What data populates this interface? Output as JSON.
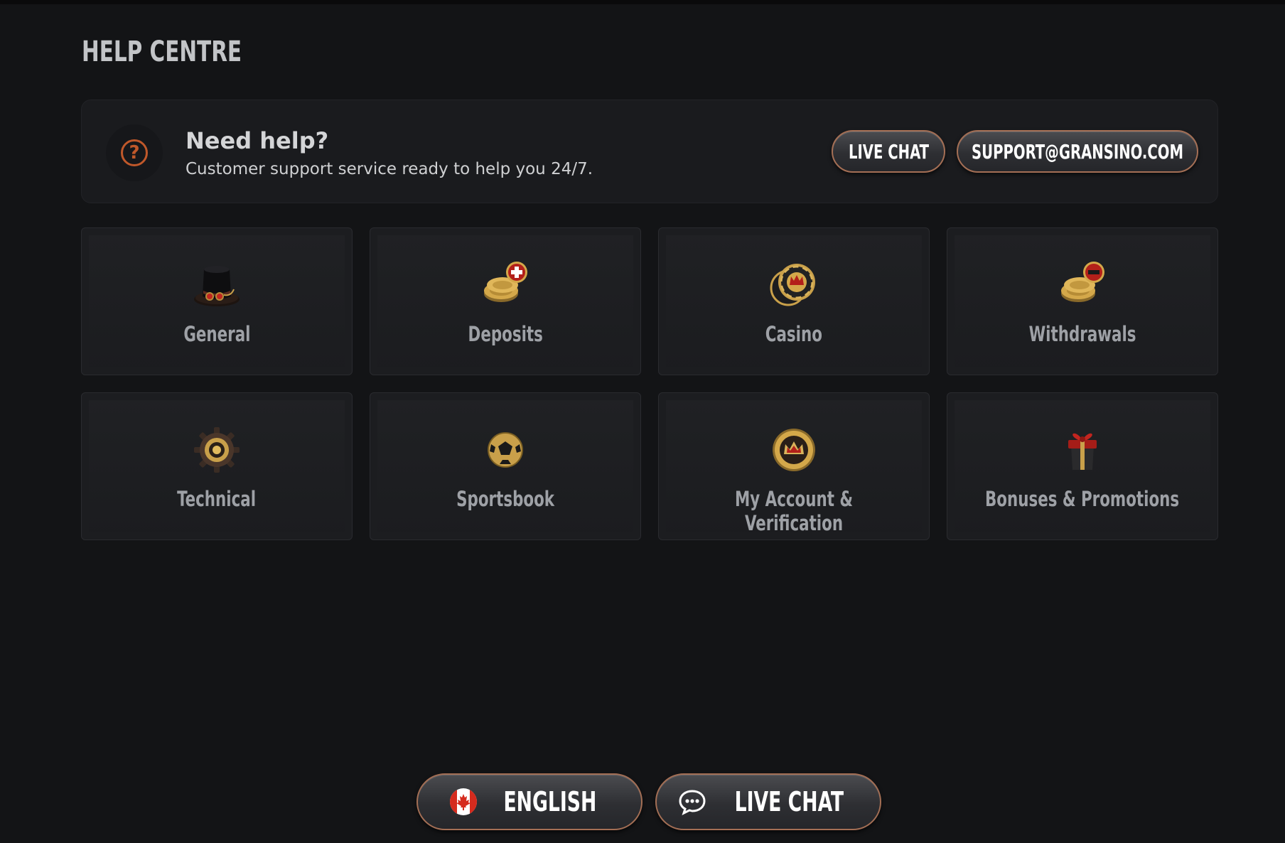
{
  "page": {
    "title": "HELP CENTRE"
  },
  "help": {
    "heading": "Need help?",
    "subtext": "Customer support service ready to help you 24/7.",
    "live_chat_label": "LIVE CHAT",
    "email_label": "SUPPORT@GRANSINO.COM"
  },
  "categories": [
    {
      "label": "General",
      "icon": "top-hat-icon"
    },
    {
      "label": "Deposits",
      "icon": "coins-plus-icon"
    },
    {
      "label": "Casino",
      "icon": "casino-chip-icon"
    },
    {
      "label": "Withdrawals",
      "icon": "coins-minus-icon"
    },
    {
      "label": "Technical",
      "icon": "gear-icon"
    },
    {
      "label": "Sportsbook",
      "icon": "soccer-ball-icon"
    },
    {
      "label": "My Account & Verification",
      "icon": "crown-badge-icon"
    },
    {
      "label": "Bonuses & Promotions",
      "icon": "gift-box-icon"
    }
  ],
  "footer": {
    "language_label": "ENGLISH",
    "language_flag": "canada-flag-icon",
    "live_chat_label": "LIVE CHAT",
    "live_chat_icon": "chat-bubble-icon"
  },
  "colors": {
    "background": "#131416",
    "accent_orange": "#c0582a",
    "pill_border": "#a46f55",
    "gold": "#d4a84a"
  }
}
